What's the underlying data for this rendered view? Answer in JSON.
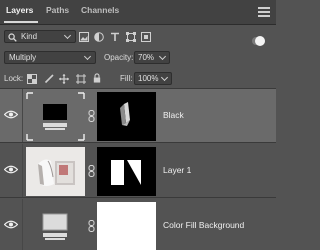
{
  "tabs": [
    {
      "label": "Layers",
      "active": true
    },
    {
      "label": "Paths",
      "active": false
    },
    {
      "label": "Channels",
      "active": false
    }
  ],
  "filter": {
    "kind_value": "Kind",
    "icons": [
      "image-filter-icon",
      "adjustment-filter-icon",
      "type-filter-icon",
      "shape-filter-icon",
      "smart-object-filter-icon"
    ],
    "toggle_on": true
  },
  "blend": {
    "mode": "Multiply",
    "opacity_label": "Opacity:",
    "opacity_value": "70%"
  },
  "lock": {
    "label": "Lock:",
    "icons": [
      "lock-transparent-pixels-icon",
      "lock-image-pixels-icon",
      "lock-position-icon",
      "lock-artboard-icon",
      "lock-all-icon"
    ],
    "fill_label": "Fill:",
    "fill_value": "100%"
  },
  "layers": [
    {
      "name": "Black",
      "selected": true,
      "visible": true
    },
    {
      "name": "Layer 1",
      "selected": false,
      "visible": true
    },
    {
      "name": "Color Fill Background",
      "selected": false,
      "visible": true
    }
  ],
  "colors": {
    "panel_bg": "#535353",
    "tab_bg": "#424242",
    "selected_row": "#6a6a6a"
  }
}
